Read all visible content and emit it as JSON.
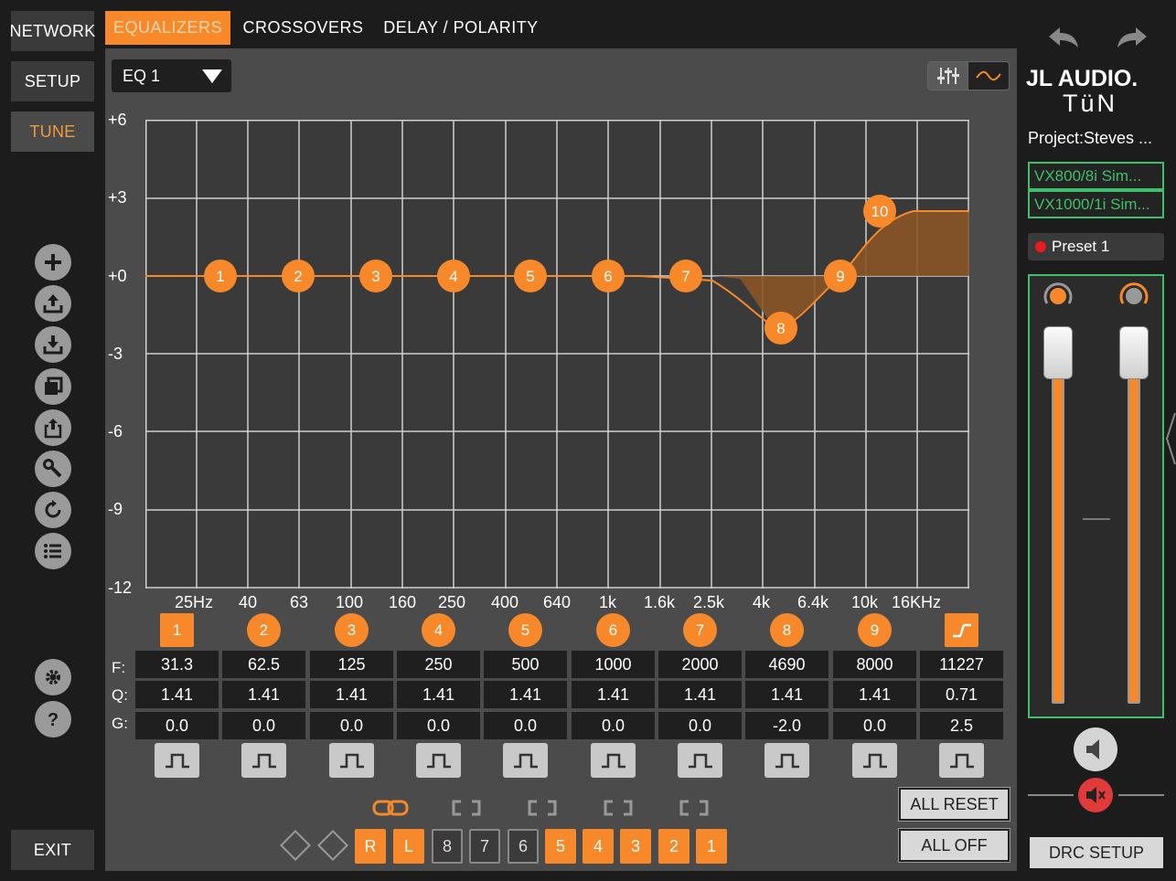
{
  "nav": {
    "network": "NETWORK",
    "setup": "SETUP",
    "tune": "TUNE",
    "exit": "EXIT"
  },
  "tabs": [
    {
      "label": "EQUALIZERS",
      "active": true
    },
    {
      "label": "CROSSOVERS",
      "active": false
    },
    {
      "label": "DELAY / POLARITY",
      "active": false
    }
  ],
  "side_tools": [
    "add-icon",
    "upload-icon",
    "download-icon",
    "copy-icon",
    "share-icon",
    "wrench-icon",
    "reset-icon",
    "list-icon"
  ],
  "bottom_tools": [
    "gear-icon",
    "help-icon"
  ],
  "eq_select": {
    "value": "EQ 1"
  },
  "graph": {
    "y_labels": [
      "+6",
      "+3",
      "+0",
      "-3",
      "-6",
      "-9",
      "-12"
    ],
    "x_labels": [
      "25Hz",
      "40",
      "63",
      "100",
      "160",
      "250",
      "400",
      "640",
      "1k",
      "1.6k",
      "2.5k",
      "4k",
      "6.4k",
      "10k",
      "16KHz"
    ],
    "ylim": [
      -12,
      6
    ],
    "curve_color": "#f7892a"
  },
  "bands": {
    "labels": [
      "1",
      "2",
      "3",
      "4",
      "5",
      "6",
      "7",
      "8",
      "9",
      "shelf"
    ],
    "row_labels": {
      "f": "F:",
      "q": "Q:",
      "g": "G:"
    },
    "freq": [
      "31.3",
      "62.5",
      "125",
      "250",
      "500",
      "1000",
      "2000",
      "4690",
      "8000",
      "11227"
    ],
    "q": [
      "1.41",
      "1.41",
      "1.41",
      "1.41",
      "1.41",
      "1.41",
      "1.41",
      "1.41",
      "1.41",
      "0.71"
    ],
    "gain": [
      "0.0",
      "0.0",
      "0.0",
      "0.0",
      "0.0",
      "0.0",
      "0.0",
      "-2.0",
      "0.0",
      "2.5"
    ],
    "graph_points": [
      "1",
      "2",
      "3",
      "4",
      "5",
      "6",
      "7",
      "8",
      "9",
      "10"
    ]
  },
  "channels": [
    "R",
    "L",
    "8",
    "7",
    "6",
    "5",
    "4",
    "3",
    "2",
    "1"
  ],
  "channels_on": [
    true,
    true,
    false,
    false,
    false,
    true,
    true,
    true,
    true,
    true
  ],
  "actions": {
    "all_reset": "ALL RESET",
    "all_off": "ALL OFF"
  },
  "brand": {
    "line1": "JL AUDIO.",
    "line2": "TüN"
  },
  "project": "Project:Steves ...",
  "devices": [
    "VX800/8i Sim...",
    "VX1000/1i Sim..."
  ],
  "preset": "Preset 1",
  "drc_setup": "DRC SETUP",
  "colors": {
    "accent": "#f7892a",
    "device_border": "#3fbf6a",
    "mute": "#e03a3a"
  }
}
